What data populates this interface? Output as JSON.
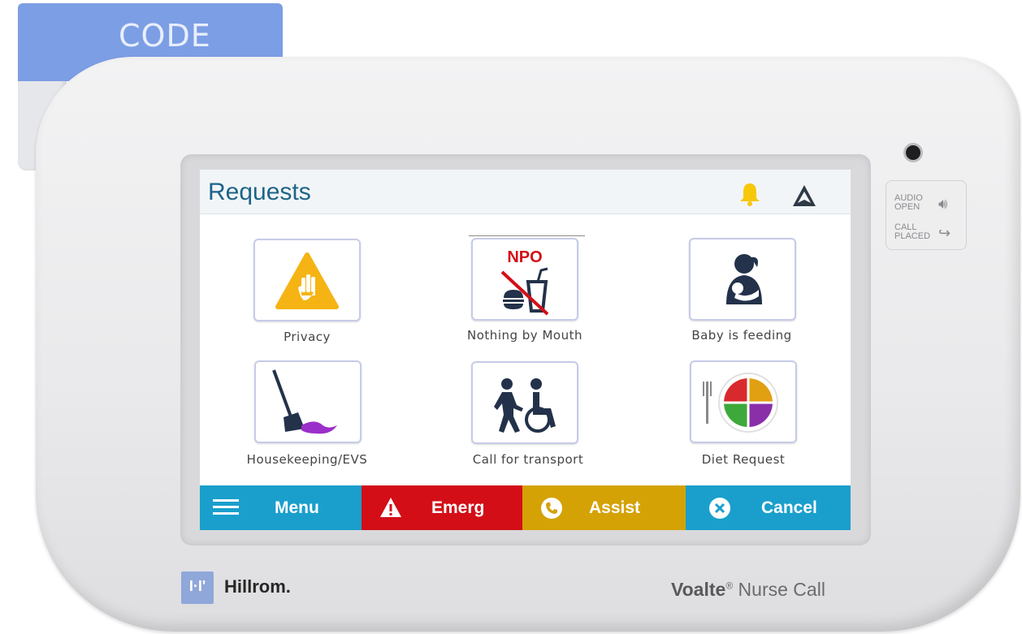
{
  "device": {
    "code_tab_label": "CODE",
    "side_panel": {
      "audio_line1": "AUDIO",
      "audio_line2": "OPEN",
      "call_line1": "CALL",
      "call_line2": "PLACED"
    },
    "brand_mark": "I·I'",
    "brand_name": "Hillrom",
    "brand_suffix": ".",
    "product_bold": "Voalte",
    "product_reg": "®",
    "product_rest": " Nurse Call"
  },
  "screen": {
    "title": "Requests",
    "header_icons": [
      "bell-icon",
      "navigation-icon"
    ],
    "tiles": [
      {
        "label": "Privacy",
        "icon": "privacy-hand-icon"
      },
      {
        "label": "Nothing by Mouth",
        "icon": "npo-icon",
        "badge": "NPO"
      },
      {
        "label": "Baby is feeding",
        "icon": "baby-feeding-icon"
      },
      {
        "label": "Housekeeping/EVS",
        "icon": "broom-icon"
      },
      {
        "label": "Call for transport",
        "icon": "transport-wheelchair-icon"
      },
      {
        "label": "Diet Request",
        "icon": "diet-plate-icon"
      }
    ],
    "bottom_bar": {
      "menu": "Menu",
      "emerg": "Emerg",
      "assist": "Assist",
      "cancel": "Cancel"
    }
  },
  "colors": {
    "title": "#1d6488",
    "menu": "#1a9fcc",
    "emerg": "#d30e17",
    "assist": "#d4a205",
    "cancel": "#1a9fcc",
    "bell": "#f7c80a",
    "code_tab": "#7c9ee4"
  }
}
